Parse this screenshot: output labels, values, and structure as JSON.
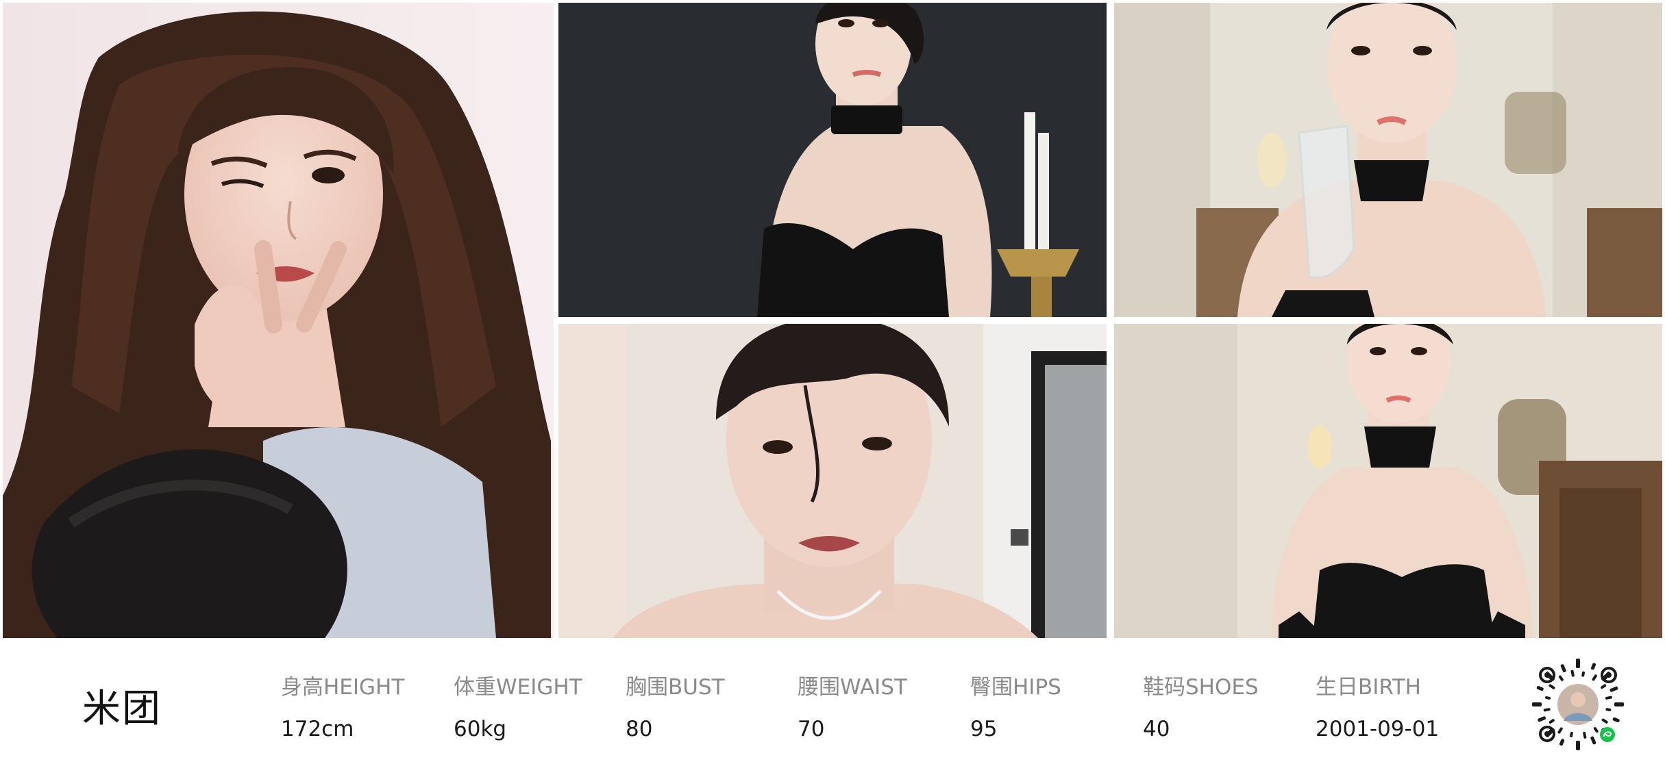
{
  "model": {
    "name": "米团"
  },
  "stats": {
    "height": {
      "label": "身高HEIGHT",
      "value": "172cm"
    },
    "weight": {
      "label": "体重WEIGHT",
      "value": "60kg"
    },
    "bust": {
      "label": "胸围BUST",
      "value": "80"
    },
    "waist": {
      "label": "腰围WAIST",
      "value": "70"
    },
    "hips": {
      "label": "臀围HIPS",
      "value": "95"
    },
    "shoes": {
      "label": "鞋码SHOES",
      "value": "40"
    },
    "birth": {
      "label": "生日BIRTH",
      "value": "2001-09-01"
    }
  },
  "colors": {
    "label_gray": "#8a8a8a",
    "value_dark": "#1a1a1a",
    "background": "#ffffff"
  },
  "icons": {
    "qr": "mini-program-qr-code-icon"
  }
}
